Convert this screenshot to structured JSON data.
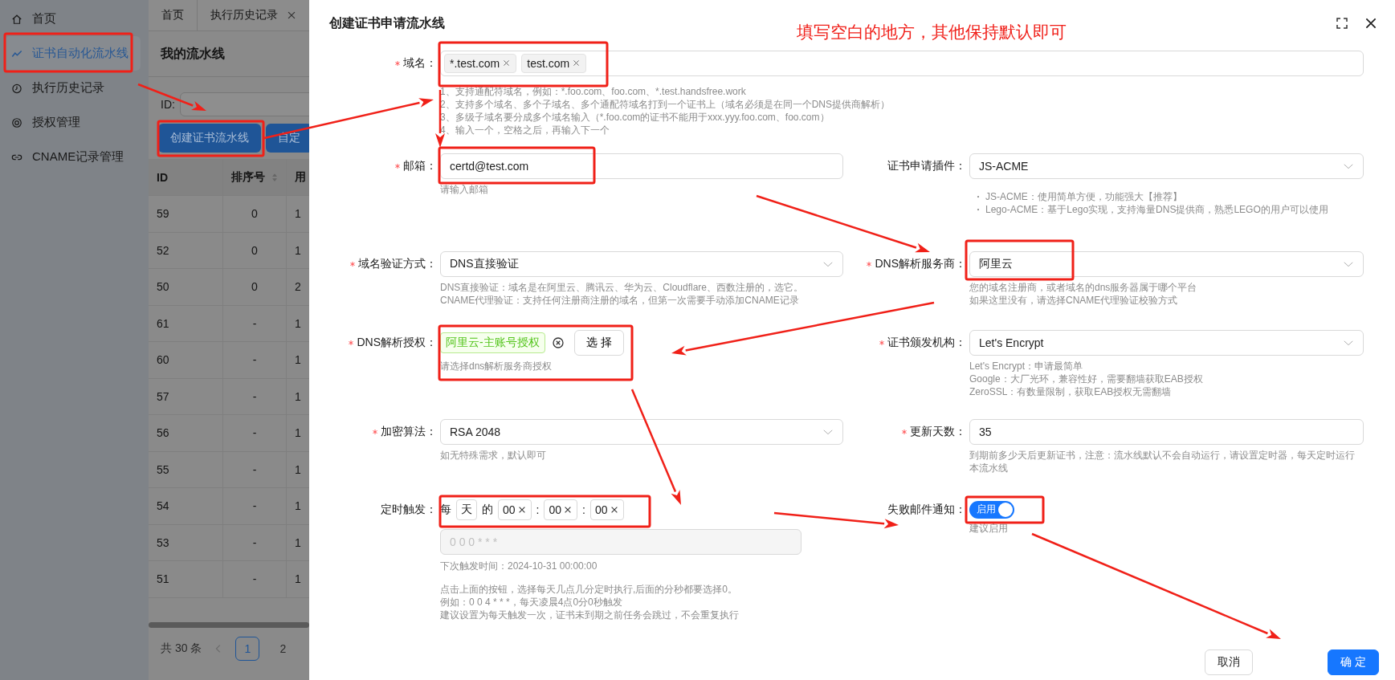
{
  "sidebar": {
    "items": [
      {
        "label": "首页",
        "selected": false
      },
      {
        "label": "证书自动化流水线",
        "selected": true
      },
      {
        "label": "执行历史记录",
        "selected": false
      },
      {
        "label": "授权管理",
        "selected": false
      },
      {
        "label": "CNAME记录管理",
        "selected": false
      }
    ]
  },
  "tabs": [
    {
      "label": "首页",
      "closable": false
    },
    {
      "label": "执行历史记录",
      "closable": true
    }
  ],
  "page": {
    "title": "我的流水线",
    "filter_label": "ID:",
    "buttons": [
      {
        "label": "创建证书流水线"
      },
      {
        "label": "自定"
      }
    ]
  },
  "table": {
    "columns": [
      {
        "label": "ID",
        "sortable": false
      },
      {
        "label": "排序号",
        "sortable": true
      },
      {
        "label": "用",
        "sortable": false
      }
    ],
    "rows": [
      [
        "59",
        "0",
        "1"
      ],
      [
        "52",
        "0",
        "1"
      ],
      [
        "50",
        "0",
        "2"
      ],
      [
        "61",
        "-",
        "1"
      ],
      [
        "60",
        "-",
        "1"
      ],
      [
        "57",
        "-",
        "1"
      ],
      [
        "56",
        "-",
        "1"
      ],
      [
        "55",
        "-",
        "1"
      ],
      [
        "54",
        "-",
        "1"
      ],
      [
        "53",
        "-",
        "1"
      ],
      [
        "51",
        "-",
        "1"
      ]
    ]
  },
  "pagination": {
    "total": "共 30 条",
    "pages": [
      {
        "label": "1",
        "selected": true
      },
      {
        "label": "2",
        "selected": false
      }
    ]
  },
  "dialog": {
    "title": "创建证书申请流水线",
    "note": "填写空白的地方，其他保持默认即可",
    "rows": [
      [
        {
          "kind": "tags",
          "label": "域名：",
          "required": true,
          "tags": [
            "*.test.com",
            "test.com"
          ],
          "help": [
            "1、支持通配符域名，例如：*.foo.com、foo.com、*.test.handsfree.work",
            "2、支持多个域名、多个子域名、多个通配符域名打到一个证书上（域名必须是在同一个DNS提供商解析）",
            "3、多级子域名要分成多个域名输入（*.foo.com的证书不能用于xxx.yyy.foo.com、foo.com）",
            "4、输入一个，空格之后，再输入下一个"
          ]
        }
      ],
      [
        {
          "kind": "input",
          "label": "邮箱：",
          "required": true,
          "value": "certd@test.com",
          "help": [
            "请输入邮箱"
          ]
        },
        {
          "kind": "select",
          "label": "证书申请插件：",
          "required": false,
          "value": "JS-ACME",
          "bullets": [
            "JS-ACME：使用简单方便，功能强大【推荐】",
            "Lego-ACME：基于Lego实现，支持海量DNS提供商，熟悉LEGO的用户可以使用"
          ]
        }
      ],
      [
        {
          "kind": "select",
          "label": "域名验证方式：",
          "required": true,
          "value": "DNS直接验证",
          "help": [
            "DNS直接验证：域名是在阿里云、腾讯云、华为云、Cloudflare、西数注册的，选它。",
            "CNAME代理验证：支持任何注册商注册的域名，但第一次需要手动添加CNAME记录"
          ]
        },
        {
          "kind": "select",
          "label": "DNS解析服务商：",
          "required": true,
          "value": "阿里云",
          "help": [
            "您的域名注册商，或者域名的dns服务器属于哪个平台",
            "如果这里没有，请选择CNAME代理验证校验方式"
          ]
        }
      ],
      [
        {
          "kind": "auth",
          "label": "DNS解析授权：",
          "required": true,
          "value": "阿里云-主账号授权",
          "button": "选 择",
          "help": [
            "请选择dns解析服务商授权"
          ]
        },
        {
          "kind": "select",
          "label": "证书颁发机构：",
          "required": true,
          "value": "Let's Encrypt",
          "help": [
            "Let's Encrypt：申请最简单",
            "Google：大厂光环，兼容性好，需要翻墙获取EAB授权",
            "ZeroSSL：有数量限制，获取EAB授权无需翻墙"
          ]
        }
      ],
      [
        {
          "kind": "select",
          "label": "加密算法：",
          "required": true,
          "value": "RSA 2048",
          "help": [
            "如无特殊需求，默认即可"
          ]
        },
        {
          "kind": "input",
          "label": "更新天数：",
          "required": true,
          "value": "35",
          "help": [
            "到期前多少天后更新证书，注意：流水线默认不会自动运行，请设置定时器，每天定时运行本流水线"
          ]
        }
      ],
      [
        {
          "kind": "timer",
          "label": "定时触发：",
          "required": false,
          "parts": [
            {
              "kind": "text",
              "text": "每"
            },
            {
              "kind": "box",
              "text": "天"
            },
            {
              "kind": "text",
              "text": "的"
            },
            {
              "kind": "clear",
              "text": "00"
            },
            {
              "kind": "text",
              "text": ":"
            },
            {
              "kind": "clear",
              "text": "00"
            },
            {
              "kind": "text",
              "text": ":"
            },
            {
              "kind": "clear",
              "text": "00"
            }
          ],
          "cron": "0 0 0 * * *",
          "next": "下次触发时间：2024-10-31 00:00:00",
          "help": [
            "点击上面的按钮，选择每天几点几分定时执行,后面的分秒都要选择0。",
            "例如：0 0 4 * * *，每天凌晨4点0分0秒触发",
            "建议设置为每天触发一次，证书未到期之前任务会跳过，不会重复执行"
          ]
        },
        {
          "kind": "switch",
          "label": "失败邮件通知：",
          "required": false,
          "on": true,
          "text": "启用",
          "help": [
            "建议启用"
          ]
        }
      ]
    ],
    "buttons": [
      {
        "label": "取消",
        "kind": "default"
      },
      {
        "label": "确 定",
        "kind": "primary"
      }
    ]
  }
}
